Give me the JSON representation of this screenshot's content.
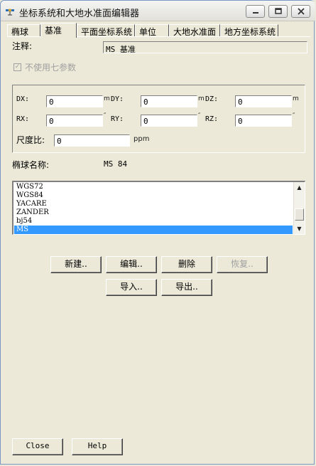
{
  "window": {
    "title": "坐标系统和大地水准面编辑器"
  },
  "tabs": [
    {
      "label": "椭球",
      "active": false
    },
    {
      "label": "基准",
      "active": true
    },
    {
      "label": "平面坐标系统",
      "active": false
    },
    {
      "label": "单位",
      "active": false
    },
    {
      "label": "大地水准面",
      "active": false
    },
    {
      "label": "地方坐标系统",
      "active": false
    }
  ],
  "datum": {
    "comment_label": "注释:",
    "comment_value": "MS 基准",
    "seven_param_label": "不使用七参数",
    "params": {
      "dx_label": "DX:",
      "dx_value": "0",
      "dx_unit": "m",
      "dy_label": "DY:",
      "dy_value": "0",
      "dy_unit": "m",
      "dz_label": "DZ:",
      "dz_value": "0",
      "dz_unit": "m",
      "rx_label": "RX:",
      "rx_value": "0",
      "rx_unit": "″",
      "ry_label": "RY:",
      "ry_value": "0",
      "ry_unit": "″",
      "rz_label": "RZ:",
      "rz_value": "0",
      "rz_unit": "″",
      "scale_label": "尺度比:",
      "scale_value": "0",
      "scale_unit": "ppm"
    },
    "ellipsoid_name_label": "椭球名称:",
    "ellipsoid_name_value": "MS 84",
    "list": {
      "items": [
        "WGS72",
        "WGS84",
        "YACARE",
        "ZANDER",
        "bj54",
        "MS"
      ],
      "selected_index": 5
    }
  },
  "buttons": {
    "new": "新建..",
    "edit": "编辑..",
    "delete": "删除",
    "restore": "恢复..",
    "import": "导入..",
    "export": "导出..",
    "close": "Close",
    "help": "Help"
  },
  "colors": {
    "selection": "#3399ff",
    "face": "#ece9d8"
  },
  "icons": {
    "app": "satellite-icon",
    "minimize": "minimize-icon",
    "maximize": "maximize-icon",
    "close": "close-icon"
  }
}
